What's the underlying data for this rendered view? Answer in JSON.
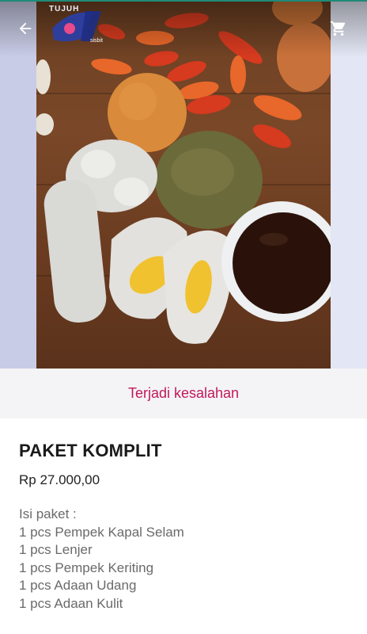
{
  "header": {
    "back_icon": "arrow-left-icon",
    "cart_icon": "shopping-cart-icon",
    "logo": {
      "text": "TUJUH",
      "subtext": "sisbit"
    }
  },
  "status": {
    "error_text": "Terjadi kesalahan",
    "error_color": "#c2185b"
  },
  "product": {
    "name": "PAKET KOMPLIT",
    "price": "Rp 27.000,00",
    "description": [
      "Isi paket :",
      "1 pcs Pempek Kapal Selam",
      "1 pcs Lenjer",
      "1 pcs Pempek Keriting",
      "1 pcs Adaan Udang",
      "1 pcs Adaan Kulit"
    ]
  },
  "colors": {
    "accent_top": "#1f8a78"
  }
}
